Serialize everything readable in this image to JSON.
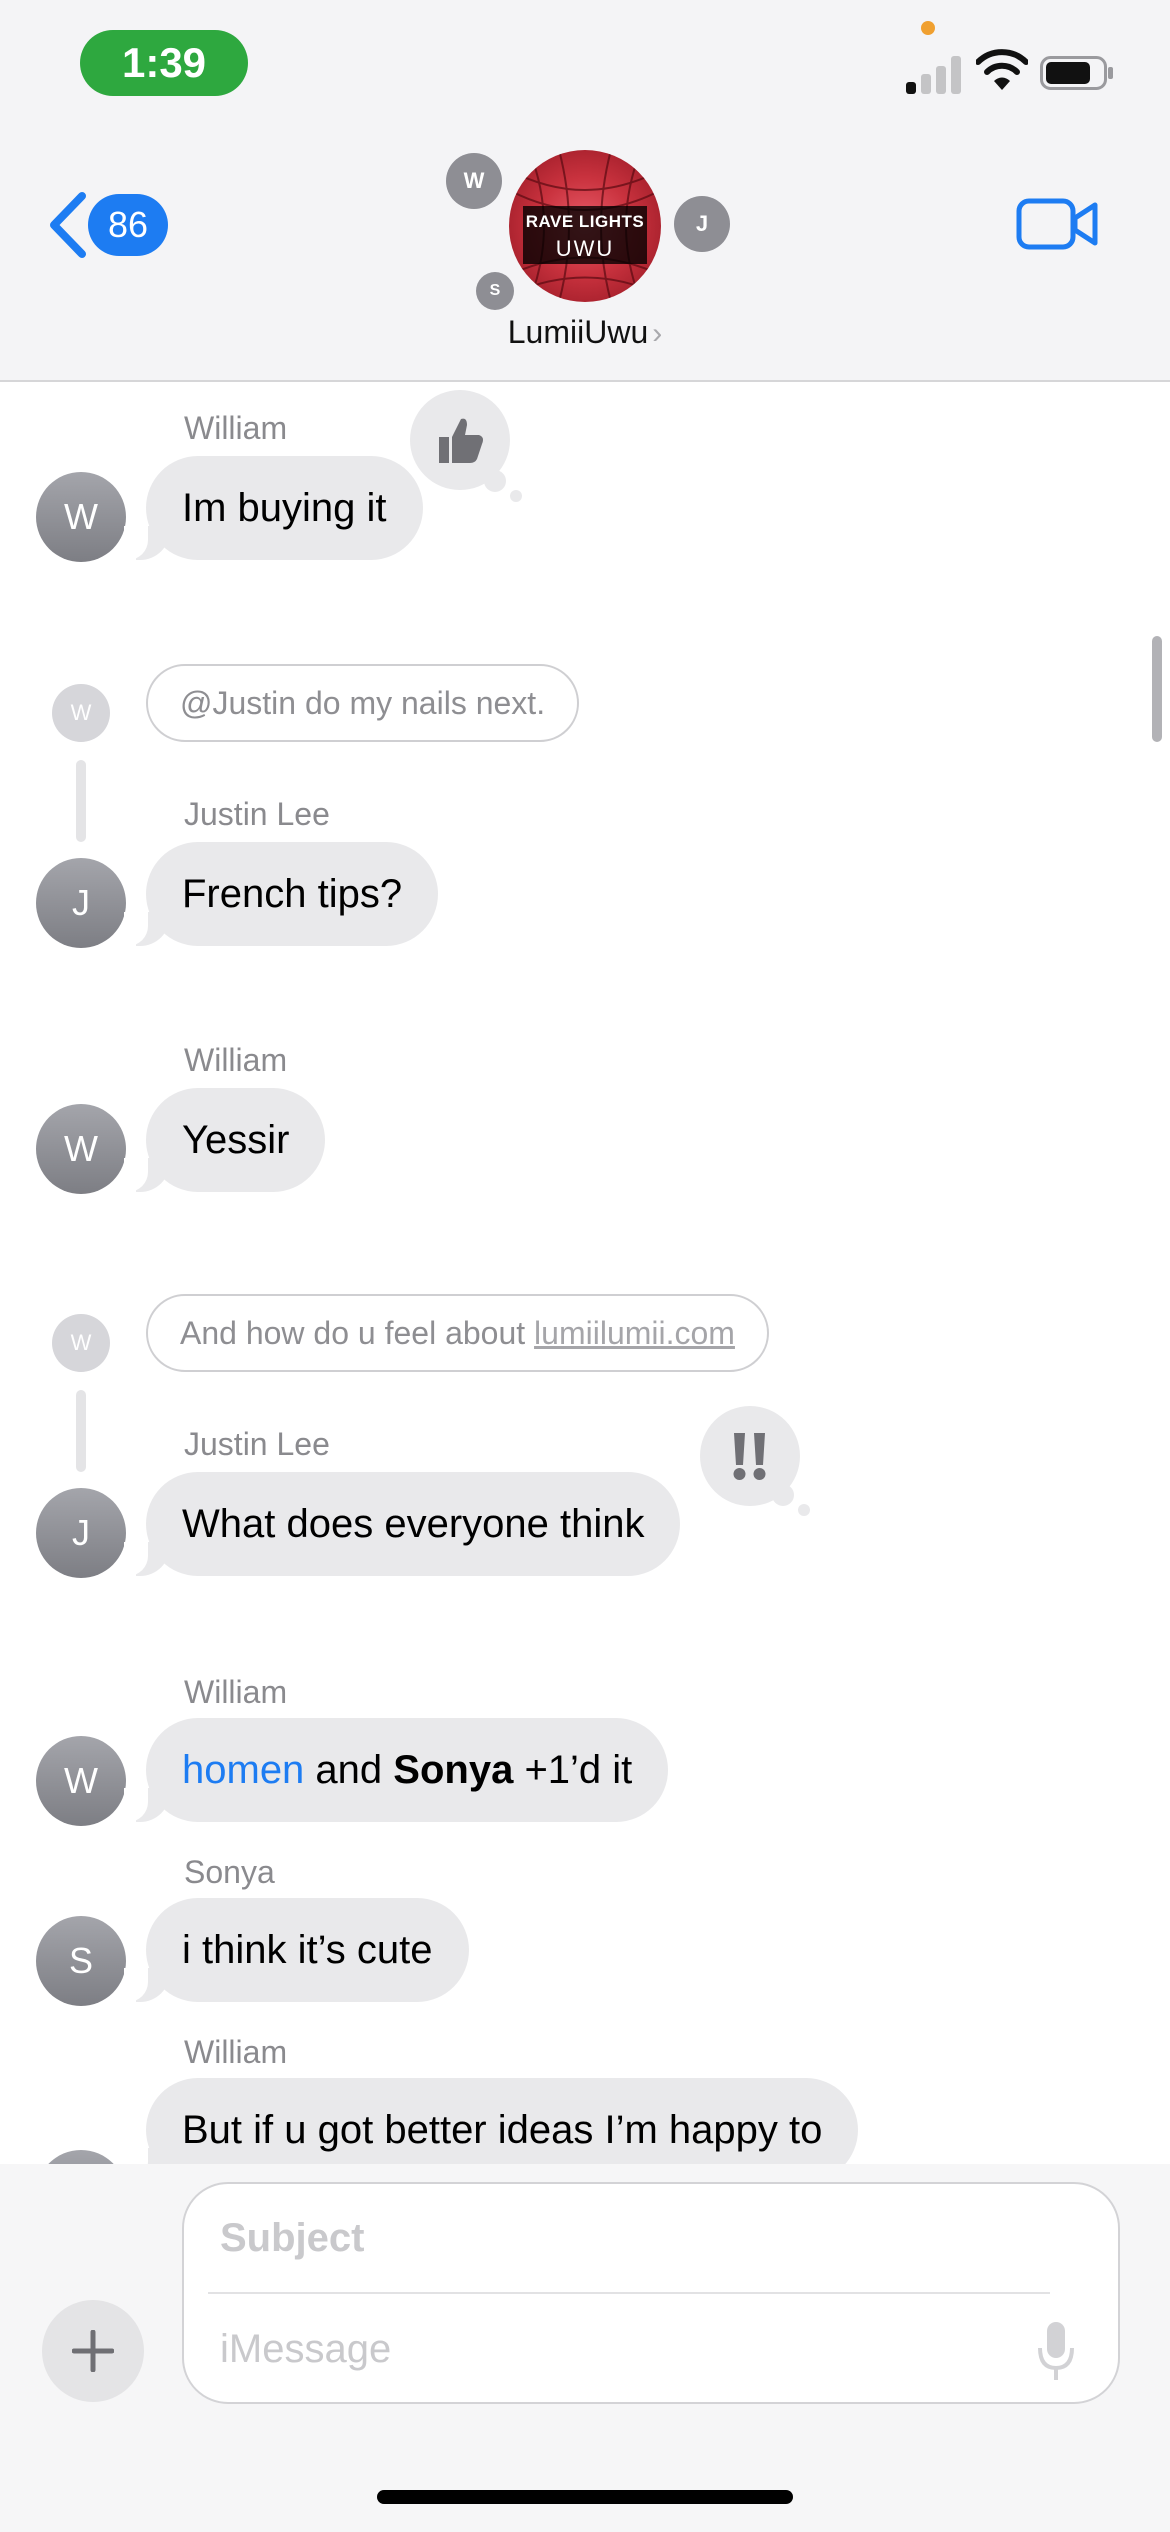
{
  "status_bar": {
    "time": "1:39",
    "icons": [
      "cellular-signal-icon",
      "wifi-icon",
      "battery-icon"
    ]
  },
  "nav": {
    "back_count": "86",
    "group_name": "LumiiUwu",
    "group_photo_text": {
      "line1": "RAVE LIGHTS",
      "line2": "UWU"
    },
    "participants": [
      "W",
      "J",
      "S"
    ]
  },
  "messages": [
    {
      "type": "message",
      "sender": "William",
      "initial": "W",
      "text": "Im buying it",
      "tapback": "thumbs-up"
    },
    {
      "type": "reply",
      "reply_initial": "W",
      "reply_text": "@Justin do my nails next.",
      "sender": "Justin Lee",
      "initial": "J",
      "text": "French tips?"
    },
    {
      "type": "message",
      "sender": "William",
      "initial": "W",
      "text": "Yessir"
    },
    {
      "type": "reply",
      "reply_initial": "W",
      "reply_text_prefix": "And how do u feel about ",
      "reply_link": "lumiilumii.com",
      "sender": "Justin Lee",
      "initial": "J",
      "text": "What does everyone think",
      "tapback": "exclamation"
    },
    {
      "type": "message",
      "sender": "William",
      "initial": "W",
      "text_mention": "homen",
      "text_middle": " and ",
      "text_bold": "Sonya",
      "text_end": " +1’d it"
    },
    {
      "type": "message",
      "sender": "Sonya",
      "initial": "S",
      "text": "i think it’s cute"
    },
    {
      "type": "message",
      "sender": "William",
      "initial": "W",
      "text": "But if u got better ideas I’m happy to"
    }
  ],
  "composer": {
    "subject_placeholder": "Subject",
    "message_placeholder": "iMessage"
  },
  "colors": {
    "accent": "#1d7cf2",
    "bubble": "#e9e9eb",
    "status_pill": "#2ea83f"
  }
}
